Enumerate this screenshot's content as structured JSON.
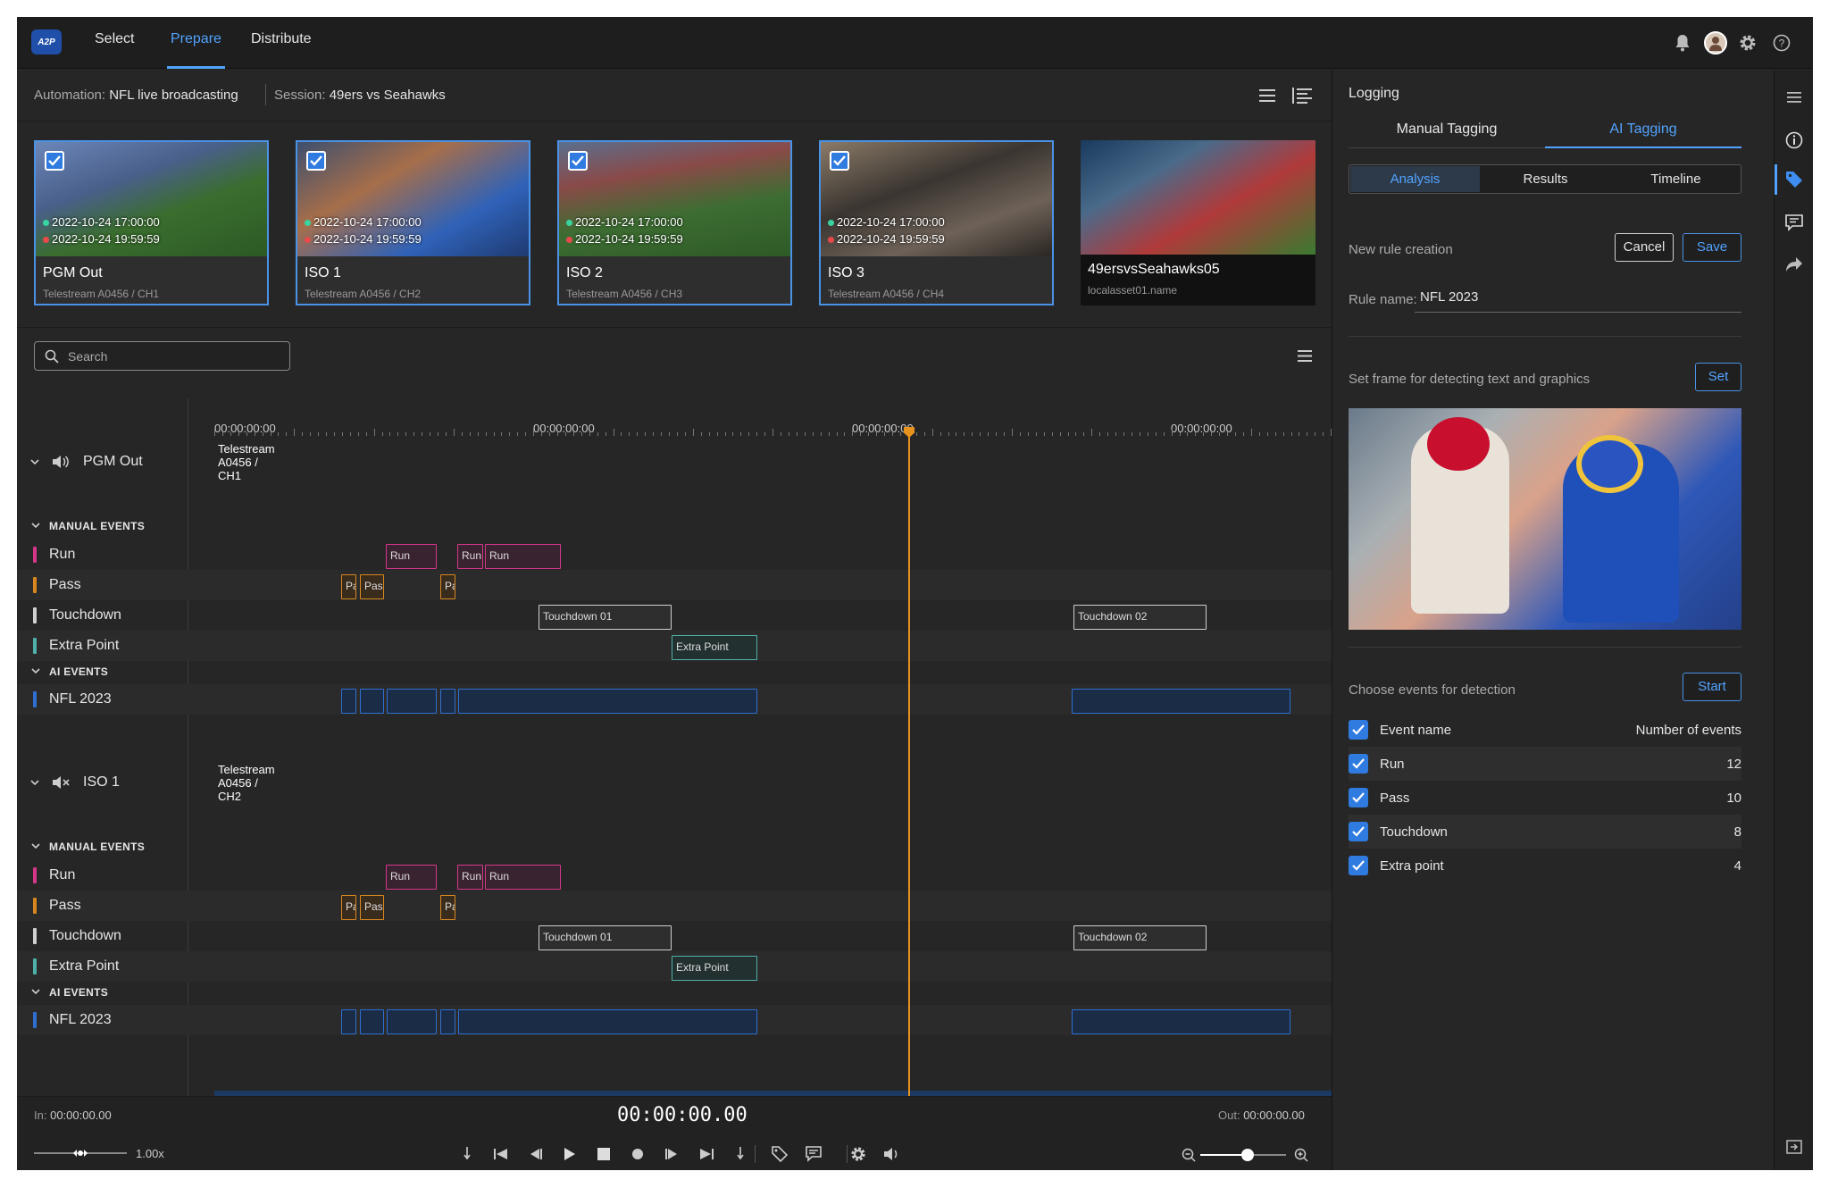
{
  "app": {
    "logo": "A2P"
  },
  "nav": {
    "tabs": [
      "Select",
      "Prepare",
      "Distribute"
    ],
    "active": "Prepare"
  },
  "header_icons": [
    "bell-icon",
    "avatar",
    "gear-icon",
    "help-icon"
  ],
  "breadcrumb": {
    "automation_label": "Automation:",
    "automation_value": "NFL live broadcasting",
    "session_label": "Session:",
    "session_value": "49ers vs Seahawks"
  },
  "sources": [
    {
      "name": "PGM Out",
      "sub": "Telestream A0456 / CH1",
      "start": "2022-10-24 17:00:00",
      "end": "2022-10-24 19:59:59",
      "checked": true
    },
    {
      "name": "ISO 1",
      "sub": "Telestream A0456 / CH2",
      "start": "2022-10-24 17:00:00",
      "end": "2022-10-24 19:59:59",
      "checked": true
    },
    {
      "name": "ISO 2",
      "sub": "Telestream A0456 / CH3",
      "start": "2022-10-24 17:00:00",
      "end": "2022-10-24 19:59:59",
      "checked": true
    },
    {
      "name": "ISO 3",
      "sub": "Telestream A0456 / CH4",
      "start": "2022-10-24 17:00:00",
      "end": "2022-10-24 19:59:59",
      "checked": true
    },
    {
      "name": "49ersvsSeahawks05",
      "sub": "localasset01.name",
      "checked": false
    }
  ],
  "search": {
    "placeholder": "Search"
  },
  "timeline": {
    "ruler": [
      "00:00:00:00",
      "00:00:00:00",
      "00:00:00:00",
      "00:00:00:00"
    ],
    "tracks": [
      {
        "name": "PGM Out",
        "clip_title": "Telestream A0456 / CH1",
        "manual_label": "MANUAL EVENTS",
        "ai_label": "AI EVENTS",
        "events": [
          "Run",
          "Pass",
          "Touchdown",
          "Extra Point"
        ],
        "ai_events": [
          "NFL 2023"
        ],
        "clips": {
          "run": [
            "Run",
            "Run",
            "Run"
          ],
          "pass": [
            "Pa",
            "Pas",
            "Pa"
          ],
          "touchdown": [
            "Touchdown 01",
            "Touchdown 02"
          ],
          "extra": [
            "Extra Point"
          ]
        }
      },
      {
        "name": "ISO 1",
        "clip_title": "Telestream A0456 / CH2",
        "manual_label": "MANUAL EVENTS",
        "ai_label": "AI EVENTS",
        "events": [
          "Run",
          "Pass",
          "Touchdown",
          "Extra Point"
        ],
        "ai_events": [
          "NFL 2023"
        ],
        "clips": {
          "run": [
            "Run",
            "Run",
            "Run"
          ],
          "pass": [
            "Pa",
            "Pas",
            "Pa"
          ],
          "touchdown": [
            "Touchdown 01",
            "Touchdown 02"
          ],
          "extra": [
            "Extra Point"
          ]
        }
      }
    ],
    "colors": {
      "run": "#d4378a",
      "pass": "#d8871f",
      "touchdown": "#d0d0d0",
      "extra": "#4fb0a8",
      "ai": "#2e6fd0",
      "playhead": "#e8921e"
    }
  },
  "transport": {
    "in_label": "In:",
    "in_value": "00:00:00.00",
    "timecode": "00:00:00.00",
    "out_label": "Out:",
    "out_value": "00:00:00.00",
    "speed": "1.00x",
    "zoom_level": 0.55,
    "speed_level": 0.5
  },
  "logging": {
    "title": "Logging",
    "tabs": [
      "Manual Tagging",
      "AI Tagging"
    ],
    "active_tab": "AI Tagging",
    "subtabs": [
      "Analysis",
      "Results",
      "Timeline"
    ],
    "active_subtab": "Analysis",
    "new_rule": "New rule creation",
    "cancel": "Cancel",
    "save": "Save",
    "rule_name_label": "Rule name:",
    "rule_name_value": "NFL 2023",
    "frame_label": "Set frame for detecting text and graphics",
    "set": "Set",
    "choose_label": "Choose events for detection",
    "start": "Start",
    "col_event": "Event name",
    "col_count": "Number of events",
    "events": [
      {
        "name": "Run",
        "count": "12"
      },
      {
        "name": "Pass",
        "count": "10"
      },
      {
        "name": "Touchdown",
        "count": "8"
      },
      {
        "name": "Extra point",
        "count": "4"
      }
    ]
  },
  "rail_icons": [
    "menu-icon",
    "info-icon",
    "tag-icon",
    "comment-icon",
    "share-icon",
    "collapse-panel-icon"
  ]
}
